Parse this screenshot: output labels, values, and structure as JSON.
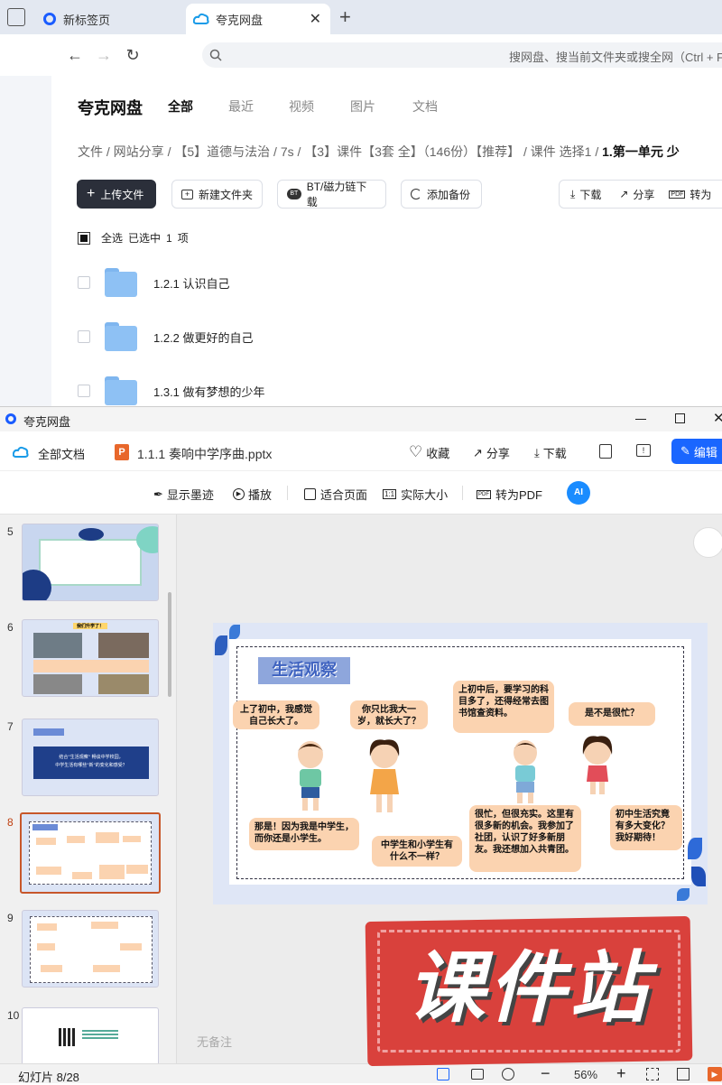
{
  "browser": {
    "tabs": [
      {
        "label": "新标签页"
      },
      {
        "label": "夸克网盘"
      }
    ],
    "address_placeholder": "搜网盘、搜当前文件夹或搜全网（Ctrl + F"
  },
  "drive": {
    "logo": "夸克网盘",
    "nav_tabs": [
      "全部",
      "最近",
      "视频",
      "图片",
      "文档"
    ],
    "breadcrumb": [
      "文件",
      "/",
      "网站分享",
      "/",
      "【5】道德与法治",
      "/",
      "7s",
      "/",
      "【3】课件【3套 全】（146份）【推荐】",
      "/",
      "课件 选择1",
      "/",
      "1.第一单元 少"
    ],
    "toolbar": {
      "upload": "上传文件",
      "new_folder": "新建文件夹",
      "bt": "BT/磁力链下载",
      "backup": "添加备份",
      "download": "下载",
      "share": "分享",
      "to_pdf": "转为"
    },
    "select_all": "全选",
    "selected_text": "已选中",
    "selected_count": "1",
    "selected_unit": "项",
    "files": [
      {
        "name": "1.2.1 认识自己"
      },
      {
        "name": "1.2.2 做更好的自己"
      },
      {
        "name": "1.3.1 做有梦想的少年"
      }
    ]
  },
  "viewer": {
    "window_title": "夸克网盘",
    "all_docs": "全部文档",
    "file_name": "1.1.1 奏响中学序曲.pptx",
    "actions": {
      "favorite": "收藏",
      "share": "分享",
      "download": "下载",
      "edit": "编辑"
    },
    "tools": {
      "ink": "显示墨迹",
      "play": "播放",
      "fit": "适合页面",
      "actual": "实际大小",
      "pdf": "转为PDF"
    },
    "thumbnails": [
      {
        "num": "5"
      },
      {
        "num": "6",
        "title": "我们升学了！"
      },
      {
        "num": "7",
        "banner": "结合\"生活观察\" 畅谈中学校园，",
        "banner2": "中学生活有哪些\"新\"的变化和感受？"
      },
      {
        "num": "8"
      },
      {
        "num": "9"
      },
      {
        "num": "10"
      }
    ],
    "no_notes": "无备注",
    "slide_counter": "幻灯片 8/28",
    "zoom": "56%"
  },
  "slide": {
    "title": "生活观察",
    "bubbles": [
      "上了初中，我感觉自己长大了。",
      "你只比我大一岁，就长大了？",
      "上初中后，要学习的科目多了，还得经常去图书馆查资料。",
      "是不是很忙？",
      "那是！因为我是中学生，而你还是小学生。",
      "中学生和小学生有什么不一样？",
      "很忙，但很充实。这里有很多新的机会。我参加了社团，认识了好多新朋友。我还想加入共青团。",
      "初中生活究竟有多大变化？我好期待！"
    ]
  },
  "watermark": "课件站",
  "colors": {
    "accent": "#1a73e8",
    "edit_btn": "#1a66ff",
    "upload_btn": "#2b2f3a",
    "bubble": "#fbd3b0",
    "watermark": "#d9413c"
  }
}
